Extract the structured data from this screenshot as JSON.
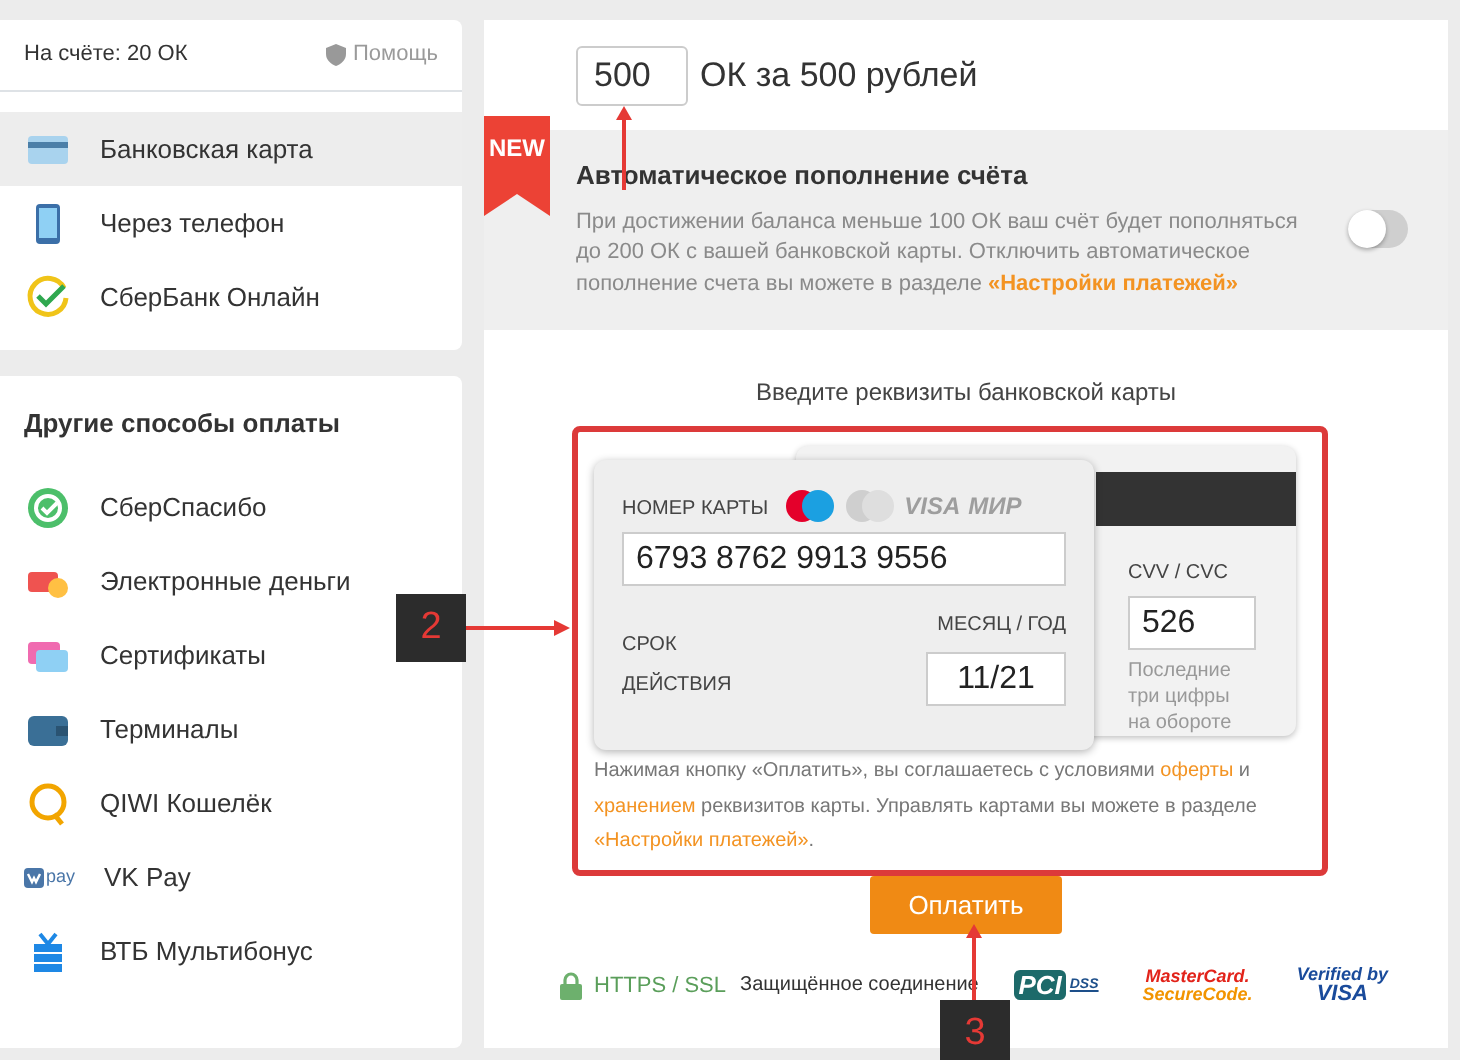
{
  "balance": "На счёте: 20 ОК",
  "help": "Помощь",
  "methods": [
    {
      "label": "Банковская карта",
      "kind": "card",
      "selected": true
    },
    {
      "label": "Через телефон",
      "kind": "phone",
      "selected": false
    },
    {
      "label": "СберБанк Онлайн",
      "kind": "sber",
      "selected": false
    }
  ],
  "other": {
    "title": "Другие способы оплаты",
    "items": [
      {
        "label": "СберСпасибо",
        "kind": "spasibo"
      },
      {
        "label": "Электронные деньги",
        "kind": "emoney"
      },
      {
        "label": "Сертификаты",
        "kind": "cert"
      },
      {
        "label": "Терминалы",
        "kind": "wallet"
      },
      {
        "label": "QIWI Кошелёк",
        "kind": "qiwi"
      },
      {
        "label": "VK Pay",
        "kind": "vkpay",
        "icon_text": "pay"
      },
      {
        "label": "ВТБ Мультибонус",
        "kind": "gift"
      }
    ]
  },
  "amount": {
    "value": "500",
    "suffix": "ОК за 500 рублей"
  },
  "autopay": {
    "badge": "NEW",
    "title": "Автоматическое пополнение счёта",
    "text": "При достижении баланса меньше 100 ОК ваш счёт будет пополняться до 200 ОК с вашей банковской карты. Отключить автоматическое пополнение счета вы можете в разделе ",
    "link": "«Настройки платежей»",
    "on": false
  },
  "card_form": {
    "heading": "Введите реквизиты банковской карты",
    "number_label": "НОМЕР КАРТЫ",
    "brands": [
      "VISA",
      "МИР"
    ],
    "number": "6793 8762 9913 9556",
    "expiry_hint": "МЕСЯЦ / ГОД",
    "expiry_label": "СРОК ДЕЙСТВИЯ",
    "expiry": "11/21",
    "cvv_label": "CVV / CVC",
    "cvv": "526",
    "cvv_hint": "Последние три цифры на обороте",
    "terms": [
      {
        "text": "Нажимая кнопку «Оплатить», вы соглашаетесь с условиями ",
        "kind": "text"
      },
      {
        "text": "оферты",
        "kind": "link"
      },
      {
        "text": " и ",
        "kind": "text"
      },
      {
        "text": "хранением",
        "kind": "link"
      },
      {
        "text": " реквизитов карты. Управлять картами вы можете в разделе ",
        "kind": "text"
      },
      {
        "text": "«Настройки платежей»",
        "kind": "link"
      },
      {
        "text": ".",
        "kind": "text"
      }
    ]
  },
  "pay_button": "Оплатить",
  "security": {
    "protocol": "HTTPS / SSL",
    "text": "Защищённое соединение",
    "logos": [
      {
        "kind": "pci",
        "parts": [
          "PCI",
          "DSS"
        ]
      },
      {
        "kind": "mastercard",
        "parts": [
          "MasterCard.",
          "SecureCode."
        ]
      },
      {
        "kind": "visa",
        "parts": [
          "Verified by",
          "VISA"
        ]
      }
    ]
  },
  "annotations": [
    {
      "label": "2",
      "kind": "card"
    },
    {
      "label": "3",
      "kind": "button"
    }
  ]
}
